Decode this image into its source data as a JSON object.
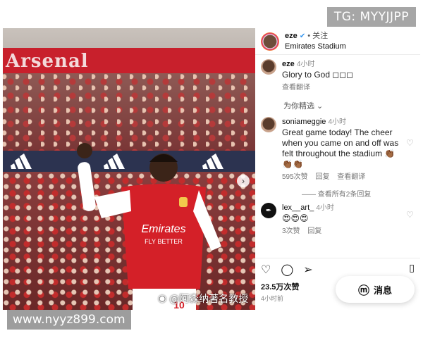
{
  "watermarks": {
    "top": "TG: MYYJJPP",
    "bottom": "www.nyyz899.com",
    "weibo": "@阿森纳著名教授"
  },
  "photo": {
    "banner_text": "Arsenal",
    "shirt_sponsor": "Emirates",
    "shirt_sponsor_sub": "FLY BETTER",
    "shirt_number": "10",
    "next_glyph": "›"
  },
  "post": {
    "username": "eze",
    "verified_glyph": "✔",
    "follow_label": "• 关注",
    "location": "Emirates Stadium"
  },
  "caption": {
    "username": "eze",
    "time": "4小时",
    "text": "Glory to God ◻◻◻",
    "translate": "查看翻译"
  },
  "sort_label": "为你精选 ⌄",
  "comments": [
    {
      "username": "soniameggie",
      "time": "4小时",
      "text": "Great game today! The cheer when you came on and off was felt throughout the stadium 👏🏾👏🏾👏🏾",
      "likes": "595次赞",
      "reply": "回复",
      "translate": "查看翻译"
    },
    {
      "username": "lex__art_",
      "time": "4小时",
      "text": "😍😍😍",
      "likes": "3次赞",
      "reply": "回复"
    }
  ],
  "view_replies": "—— 查看所有2条回复",
  "actions": {
    "likes_count": "23.5万次赞",
    "time": "4小时前",
    "message_label": "消息"
  }
}
